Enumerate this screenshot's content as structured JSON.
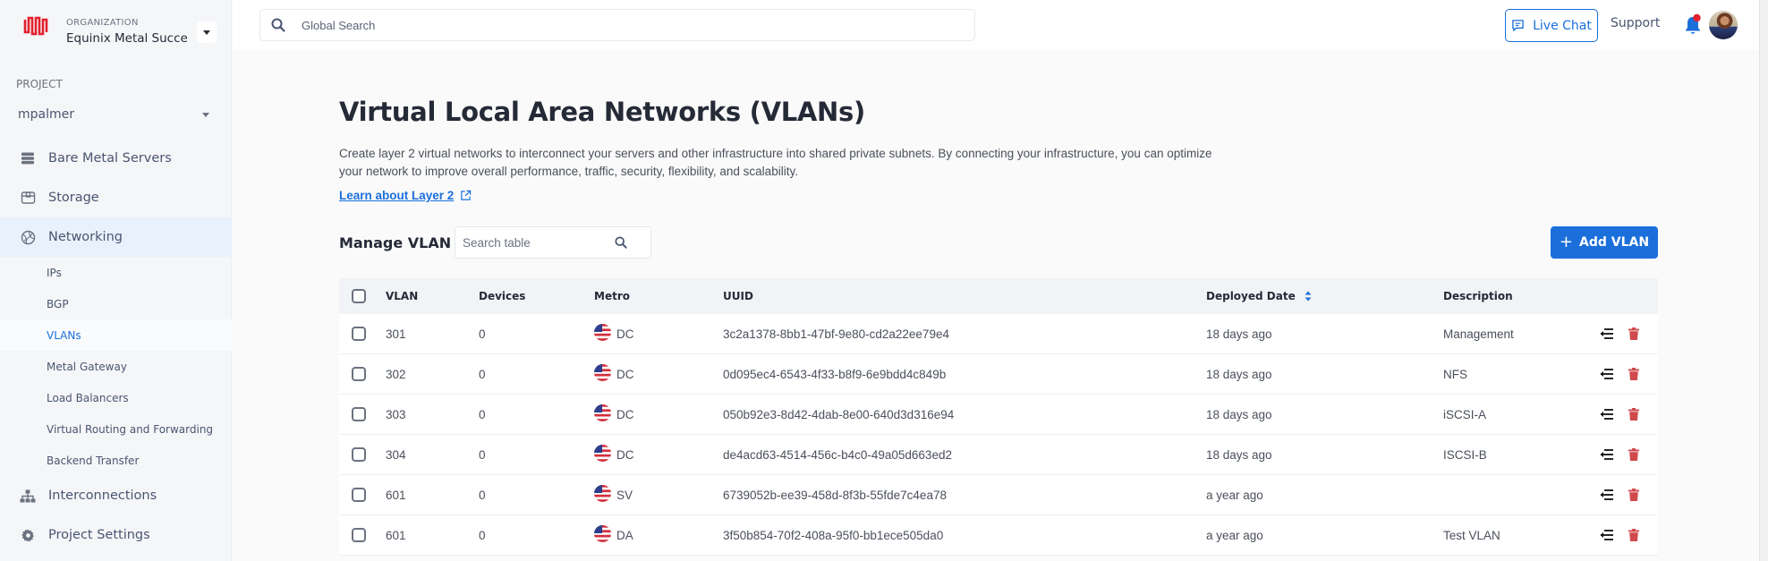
{
  "org": {
    "label": "ORGANIZATION",
    "name": "Equinix Metal Success"
  },
  "project": {
    "label": "PROJECT",
    "name": "mpalmer"
  },
  "sidebar": {
    "items": [
      {
        "label": "Bare Metal Servers",
        "icon": "server-icon"
      },
      {
        "label": "Storage",
        "icon": "storage-box-icon"
      },
      {
        "label": "Networking",
        "icon": "globe-icon",
        "active": true
      },
      {
        "label": "Interconnections",
        "icon": "hierarchy-icon"
      },
      {
        "label": "Project Settings",
        "icon": "gear-icon"
      }
    ],
    "sub_items": [
      {
        "label": "IPs"
      },
      {
        "label": "BGP"
      },
      {
        "label": "VLANs",
        "active": true
      },
      {
        "label": "Metal Gateway"
      },
      {
        "label": "Load Balancers"
      },
      {
        "label": "Virtual Routing and Forwarding"
      },
      {
        "label": "Backend Transfer"
      }
    ]
  },
  "topbar": {
    "search_placeholder": "Global Search",
    "live_chat_label": "Live Chat",
    "support_label": "Support",
    "notification_dot": true
  },
  "page": {
    "title": "Virtual Local Area Networks (VLANs)",
    "description": "Create layer 2 virtual networks to interconnect your servers and other infrastructure into shared private subnets. By connecting your infrastructure, you can optimize your network to improve overall performance, traffic, security, flexibility, and scalability.",
    "learn_link": "Learn about Layer 2"
  },
  "manage": {
    "label": "Manage VLAN",
    "search_placeholder": "Search table",
    "add_button": "Add VLAN",
    "add_icon": "+"
  },
  "table": {
    "columns": [
      "VLAN",
      "Devices",
      "Metro",
      "UUID",
      "Deployed Date",
      "Description"
    ],
    "sorted_column": "Deployed Date",
    "rows": [
      {
        "vlan": "301",
        "devices": "0",
        "metro": "DC",
        "uuid": "3c2a1378-8bb1-47bf-9e80-cd2a22ee79e4",
        "deployed": "18 days ago",
        "description": "Management"
      },
      {
        "vlan": "302",
        "devices": "0",
        "metro": "DC",
        "uuid": "0d095ec4-6543-4f33-b8f9-6e9bdd4c849b",
        "deployed": "18 days ago",
        "description": "NFS"
      },
      {
        "vlan": "303",
        "devices": "0",
        "metro": "DC",
        "uuid": "050b92e3-8d42-4dab-8e00-640d3d316e94",
        "deployed": "18 days ago",
        "description": "iSCSI-A"
      },
      {
        "vlan": "304",
        "devices": "0",
        "metro": "DC",
        "uuid": "de4acd63-4514-456c-b4c0-49a05d663ed2",
        "deployed": "18 days ago",
        "description": "ISCSI-B"
      },
      {
        "vlan": "601",
        "devices": "0",
        "metro": "SV",
        "uuid": "6739052b-ee39-458d-8f3b-55fde7c4ea78",
        "deployed": "a year ago",
        "description": ""
      },
      {
        "vlan": "601",
        "devices": "0",
        "metro": "DA",
        "uuid": "3f50b854-70f2-408a-95f0-bb1ece505da0",
        "deployed": "a year ago",
        "description": "Test VLAN"
      }
    ]
  },
  "colors": {
    "accent": "#1a6fdb",
    "brand_red": "#e4202e",
    "delete_red": "#d0494c",
    "active_nav_bg": "#e8f1fc"
  }
}
